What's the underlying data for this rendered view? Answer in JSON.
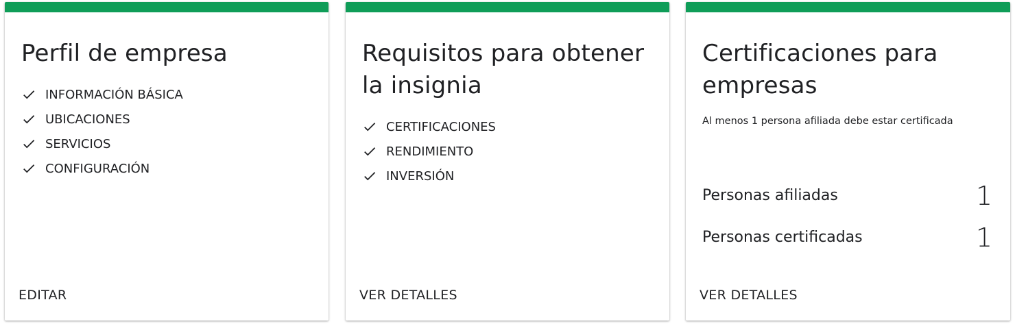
{
  "accent_color": "#0f9d58",
  "cards": [
    {
      "title": "Perfil de empresa",
      "items": [
        "INFORMACIÓN BÁSICA",
        "UBICACIONES",
        "SERVICIOS",
        "CONFIGURACIÓN"
      ],
      "action": "EDITAR"
    },
    {
      "title": "Requisitos para obtener la insignia",
      "items": [
        "CERTIFICACIONES",
        "RENDIMIENTO",
        "INVERSIÓN"
      ],
      "action": "VER DETALLES"
    },
    {
      "title": "Certificaciones para empresas",
      "subtitle": "Al menos 1 persona afiliada debe estar certificada",
      "stats": [
        {
          "label": "Personas afiliadas",
          "value": "1"
        },
        {
          "label": "Personas certificadas",
          "value": "1"
        }
      ],
      "action": "VER DETALLES"
    }
  ]
}
